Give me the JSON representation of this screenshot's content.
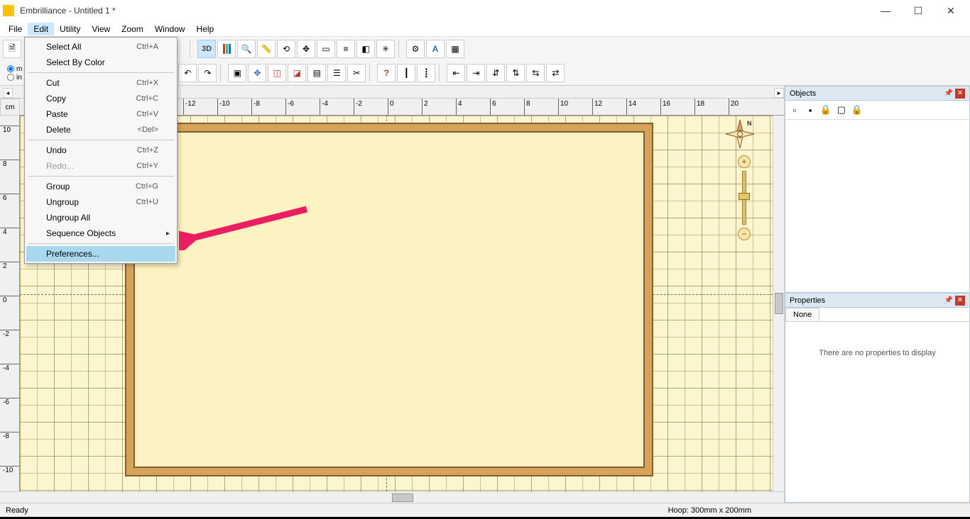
{
  "window": {
    "title": "Embrilliance -   Untitled 1 *"
  },
  "menubar": [
    "File",
    "Edit",
    "Utility",
    "View",
    "Zoom",
    "Window",
    "Help"
  ],
  "edit_menu": {
    "groups": [
      [
        {
          "label": "Select All",
          "shortcut": "Ctrl+A",
          "enabled": true
        },
        {
          "label": "Select By Color",
          "shortcut": "",
          "enabled": true
        }
      ],
      [
        {
          "label": "Cut",
          "shortcut": "Ctrl+X",
          "enabled": true
        },
        {
          "label": "Copy",
          "shortcut": "Ctrl+C",
          "enabled": true
        },
        {
          "label": "Paste",
          "shortcut": "Ctrl+V",
          "enabled": true
        },
        {
          "label": "Delete",
          "shortcut": "<Del>",
          "enabled": true
        }
      ],
      [
        {
          "label": "Undo",
          "shortcut": "Ctrl+Z",
          "enabled": true
        },
        {
          "label": "Redo...",
          "shortcut": "Ctrl+Y",
          "enabled": false
        }
      ],
      [
        {
          "label": "Group",
          "shortcut": "Ctrl+G",
          "enabled": true
        },
        {
          "label": "Ungroup",
          "shortcut": "Ctrl+U",
          "enabled": true
        },
        {
          "label": "Ungroup All",
          "shortcut": "",
          "enabled": true
        },
        {
          "label": "Sequence Objects",
          "shortcut": "",
          "enabled": true,
          "submenu": true
        }
      ],
      [
        {
          "label": "Preferences...",
          "shortcut": "",
          "enabled": true,
          "highlight": true
        }
      ]
    ]
  },
  "ruler": {
    "unit": "cm",
    "h_ticks": [
      -12,
      -10,
      -8,
      -6,
      -4,
      -2,
      0,
      2,
      4,
      6,
      8,
      10,
      12,
      14,
      16,
      18,
      20
    ],
    "v_ticks": [
      -10,
      -8,
      -6,
      -4,
      -2,
      0,
      2,
      4,
      6,
      8,
      10
    ]
  },
  "side": {
    "objects": {
      "title": "Objects"
    },
    "properties": {
      "title": "Properties",
      "tab": "None",
      "empty_text": "There are no properties to display"
    }
  },
  "status": {
    "ready": "Ready",
    "hoop": "Hoop:  300mm x 200mm"
  },
  "toolbar_icons": {
    "row1_left": [
      "new-icon",
      "open-icon",
      "save-icon",
      "merge-icon",
      "print-icon"
    ],
    "row1_mid": [
      "view3d-icon",
      "colorbars-icon",
      "magnify-icon",
      "ruler-icon",
      "measure-icon",
      "select-icon",
      "hoop-icon",
      "column-icon",
      "rotate-icon",
      "thread-icon"
    ],
    "row1_right": [
      "gear-icon",
      "text-icon",
      "layout-icon"
    ],
    "row2_a": [
      "undo-icon",
      "redo-icon"
    ],
    "row2_b": [
      "align-center-icon",
      "fit-icon",
      "group-red-icon",
      "ungroup-red-icon",
      "align-left-icon",
      "align-list-icon",
      "cut-icon"
    ],
    "row2_c": [
      "help-icon",
      "needle-icon",
      "needle2-icon"
    ],
    "row2_d": [
      "snap-h-icon",
      "snap-v-icon",
      "mirror-icon",
      "snap2-icon",
      "snap3-icon",
      "snap4-icon"
    ]
  }
}
